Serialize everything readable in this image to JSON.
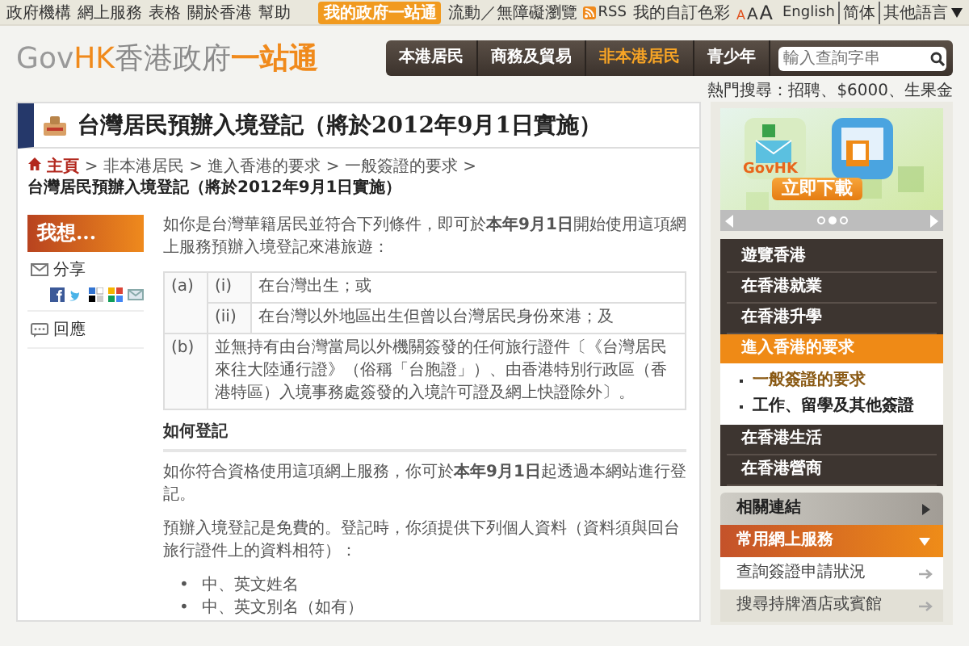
{
  "top_bar": {
    "links": [
      "政府機構",
      "網上服務",
      "表格",
      "關於香港",
      "幫助"
    ],
    "my_govhk": "我的政府一站通",
    "accessibility": "流動／無障礙瀏覽",
    "rss": "RSS",
    "custom_colors": "我的自訂色彩",
    "font_sizes": [
      {
        "label": "A",
        "selected": true
      },
      {
        "label": "A",
        "selected": false
      },
      {
        "label": "A",
        "selected": false
      }
    ],
    "languages": [
      "English",
      "简体",
      "其他語言"
    ]
  },
  "header": {
    "logo": {
      "brand": "GovHK",
      "name": "香港政府",
      "highlight": "一站通"
    },
    "nav": [
      {
        "label": "本港居民",
        "selected": false
      },
      {
        "label": "商務及貿易",
        "selected": false
      },
      {
        "label": "非本港居民",
        "selected": true
      },
      {
        "label": "青少年",
        "selected": false
      }
    ],
    "search": {
      "placeholder": "輸入查詢字串"
    },
    "hot_search": "熱門搜尋：招聘、$6000、生果金"
  },
  "page": {
    "title": "台灣居民預辦入境登記（將於2012年9月1日實施）",
    "breadcrumb": {
      "separator": ">",
      "items": [
        "主頁",
        "非本港居民",
        "進入香港的要求",
        "一般簽證的要求",
        "台灣居民預辦入境登記（將於2012年9月1日實施）"
      ]
    },
    "sidebar": {
      "banner": "我想...",
      "share": "分享",
      "feedback": "回應"
    },
    "intro": "如你是台灣華籍居民並符合下列條件，即可於**本年9月1日**開始使用這項網上服務預辦入境登記來港旅遊：",
    "conditions": [
      {
        "label": "(a)",
        "items": [
          {
            "label": "(i)",
            "text": "在台灣出生；或"
          },
          {
            "label": "(ii)",
            "text": "在台灣以外地區出生但曾以台灣居民身份來港；及"
          }
        ]
      },
      {
        "label": "(b)",
        "text": "並無持有由台灣當局以外機關簽發的任何旅行證件〔《台灣居民來往大陸通行證》（俗稱「台胞證」）、由香港特別行政區（香港特區）入境事務處簽發的入境許可證及網上快證除外〕。"
      }
    ],
    "heading": "如何登記",
    "paragraphs": [
      "如你符合資格使用這項網上服務，你可於**本年9月1日**起透過本網站進行登記。",
      "預辦入境登記是免費的。登記時，你須提供下列個人資料（資料須與回台旅行證件上的資料相符）："
    ],
    "bullets": [
      {
        "marker": "•",
        "text": "中、英文姓名"
      },
      {
        "marker": "•",
        "text": "中、英文別名（如有）"
      }
    ]
  },
  "right": {
    "promo": {
      "app_label": "GovHK",
      "button": "立即下載",
      "dots": [
        {
          "selected": false
        },
        {
          "selected": true
        },
        {
          "selected": false
        }
      ]
    },
    "menu": [
      {
        "label": "遊覽香港",
        "selected": false
      },
      {
        "label": "在香港就業",
        "selected": false
      },
      {
        "label": "在香港升學",
        "selected": false
      },
      {
        "label": "進入香港的要求",
        "selected": true,
        "children": [
          {
            "label": "一般簽證的要求",
            "selected": true
          },
          {
            "label": "工作、留學及其他簽證",
            "selected": false
          }
        ]
      },
      {
        "label": "在香港生活",
        "selected": false
      },
      {
        "label": "在香港營商",
        "selected": false
      }
    ],
    "accordion": [
      {
        "title": "相關連結",
        "expanded": false
      },
      {
        "title": "常用網上服務",
        "expanded": true,
        "items": [
          "查詢簽證申請狀況",
          "搜尋持牌酒店或賓館"
        ]
      }
    ]
  }
}
